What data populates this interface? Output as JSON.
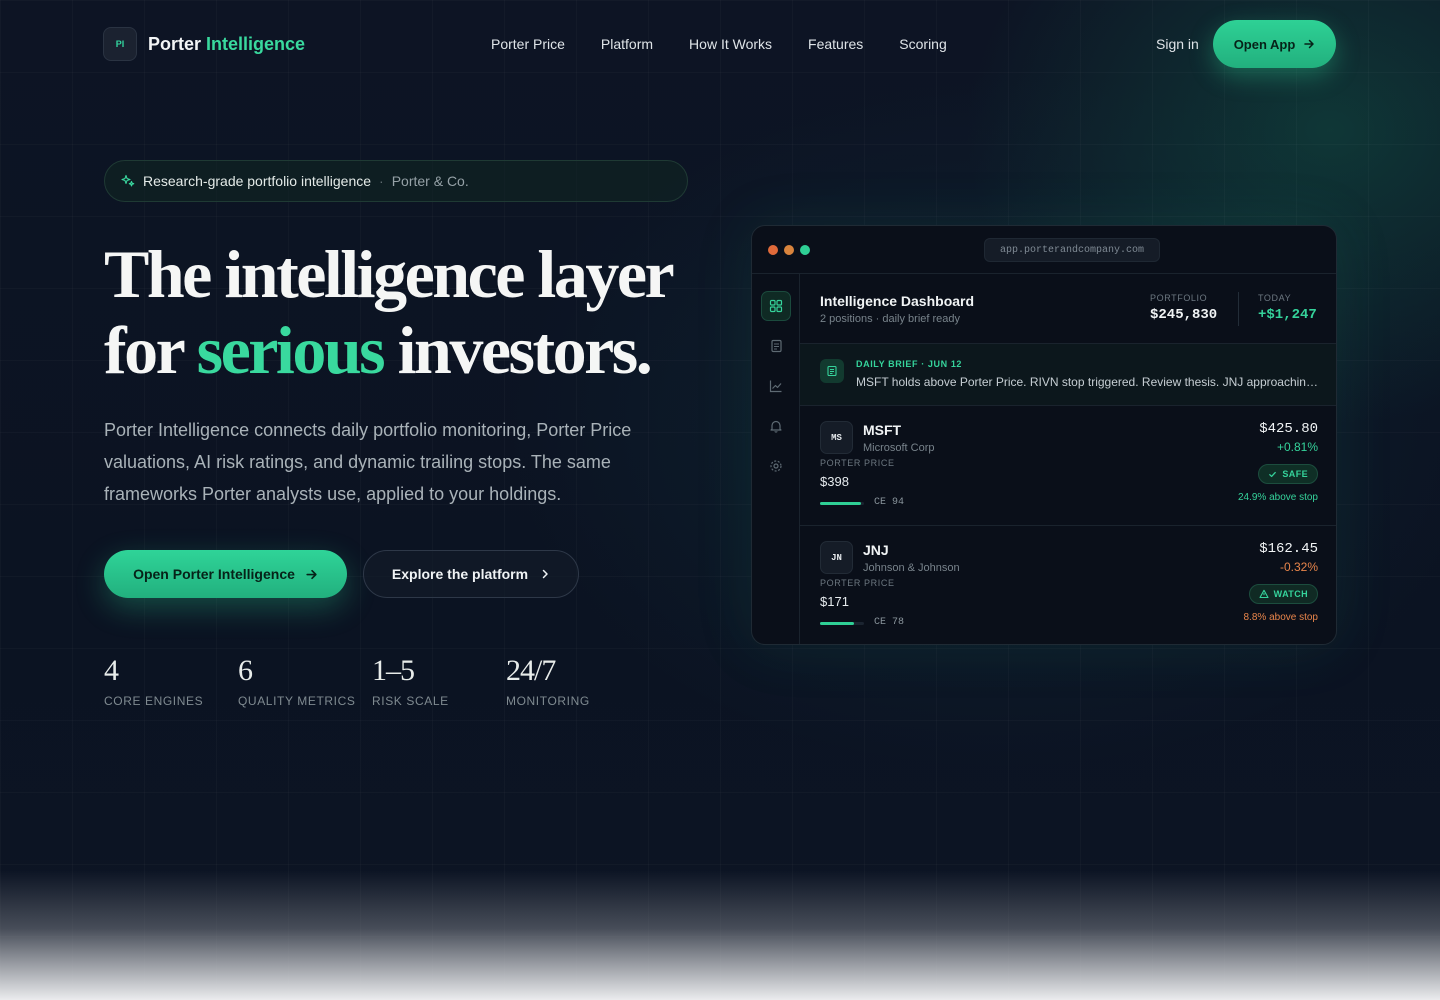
{
  "nav": {
    "logo_mark": "PI",
    "brand_primary": "Porter",
    "brand_accent": "Intelligence",
    "links": [
      "Porter Price",
      "Platform",
      "How It Works",
      "Features",
      "Scoring"
    ],
    "sign_in": "Sign in",
    "open_app": "Open App"
  },
  "badge": {
    "text": "Research-grade portfolio intelligence",
    "separator": "·",
    "org": "Porter & Co."
  },
  "hero": {
    "line1": "The intelligence layer",
    "line2_prefix": "for",
    "line2_accent": "serious",
    "line2_suffix": "investors.",
    "subtitle": "Porter Intelligence connects daily portfolio monitoring, Porter Price valuations, AI risk ratings, and dynamic trailing stops. The same frameworks Porter analysts use, applied to your holdings.",
    "cta_primary": "Open Porter Intelligence",
    "cta_secondary": "Explore the platform"
  },
  "stats": [
    {
      "value": "4",
      "label": "CORE ENGINES"
    },
    {
      "value": "6",
      "label": "QUALITY METRICS"
    },
    {
      "value": "1–5",
      "label": "RISK SCALE"
    },
    {
      "value": "24/7",
      "label": "MONITORING"
    }
  ],
  "dashboard": {
    "url": "app.porterandcompany.com",
    "title": "Intelligence Dashboard",
    "subtitle": "2 positions · daily brief ready",
    "portfolio_label": "PORTFOLIO",
    "portfolio_value": "$245,830",
    "today_label": "TODAY",
    "today_value": "+$1,247",
    "brief_label": "DAILY BRIEF · JUN 12",
    "brief_text": "MSFT holds above Porter Price. RIVN stop triggered. Review thesis. JNJ approaching support.",
    "sidebar_icons": [
      "dashboard-icon",
      "document-icon",
      "chart-icon",
      "bell-icon",
      "gear-icon"
    ],
    "positions": [
      {
        "short": "MS",
        "ticker": "MSFT",
        "company": "Microsoft Corp",
        "porter_price_label": "PORTER PRICE",
        "porter_price": "$398",
        "ce": "CE 94",
        "ce_score": 94,
        "price": "$425.80",
        "change": "+0.81%",
        "status": "SAFE",
        "stop": "24.9% above stop"
      },
      {
        "short": "JN",
        "ticker": "JNJ",
        "company": "Johnson & Johnson",
        "porter_price_label": "PORTER PRICE",
        "porter_price": "$171",
        "ce": "CE 78",
        "ce_score": 78,
        "price": "$162.45",
        "change": "-0.32%",
        "status": "WATCH",
        "stop": "8.8% above stop"
      }
    ]
  },
  "colors": {
    "accent": "#39d99e",
    "negative": "#e8854b",
    "background": "#0c1220"
  }
}
